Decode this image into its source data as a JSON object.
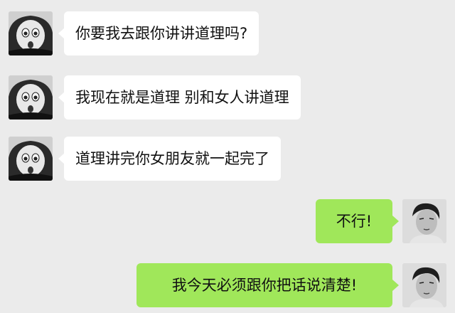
{
  "messages": [
    {
      "side": "left",
      "text": "你要我去跟你讲讲道理吗?",
      "avatar": "child-avatar"
    },
    {
      "side": "left",
      "text": "我现在就是道理 别和女人讲道理",
      "avatar": "child-avatar"
    },
    {
      "side": "left",
      "text": "道理讲完你女朋友就一起完了",
      "avatar": "child-avatar"
    },
    {
      "side": "right",
      "text": "不行!",
      "avatar": "man-avatar"
    },
    {
      "side": "right",
      "text": "我今天必须跟你把话说清楚!",
      "avatar": "man-avatar"
    }
  ],
  "colors": {
    "background": "#ebebeb",
    "incoming_bubble": "#ffffff",
    "outgoing_bubble": "#a0e75a"
  }
}
